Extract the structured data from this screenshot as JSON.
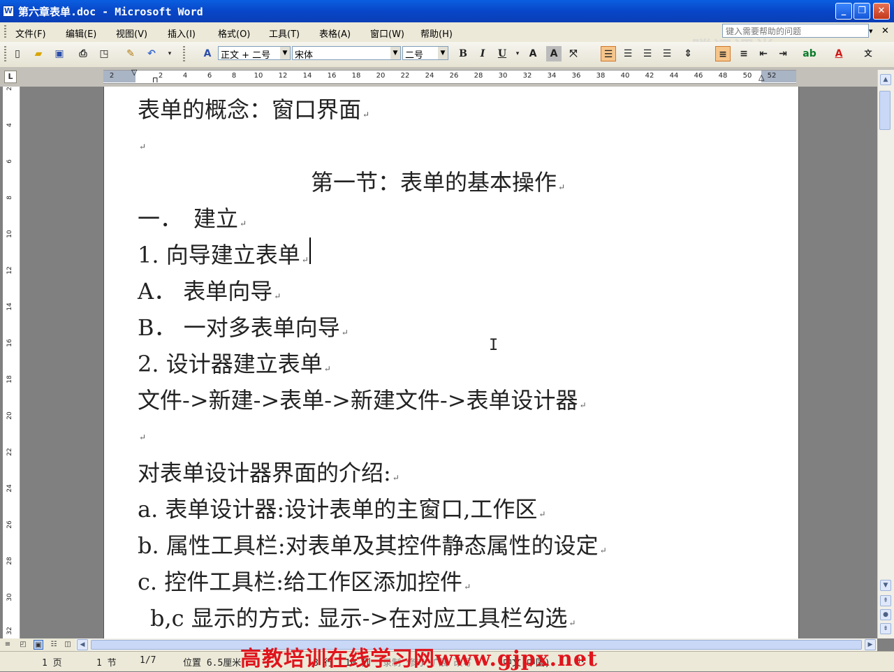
{
  "window": {
    "title": "第六章表单.doc - Microsoft Word",
    "icon": "word-doc-icon",
    "controls": {
      "minimize": "_",
      "maximize": "❐",
      "close": "✕"
    }
  },
  "menu": {
    "items": [
      "文件(F)",
      "编辑(E)",
      "视图(V)",
      "插入(I)",
      "格式(O)",
      "工具(T)",
      "表格(A)",
      "窗口(W)",
      "帮助(H)"
    ],
    "help_placeholder": "键入需要帮助的问题",
    "close_doc": "✕"
  },
  "toolbar": {
    "style": "正文 + 二号",
    "font": "宋体",
    "size": "二号",
    "bold": "B",
    "italic": "I",
    "underline": "U"
  },
  "ruler": {
    "ticks": [
      "2",
      "2",
      "4",
      "6",
      "8",
      "10",
      "12",
      "14",
      "16",
      "18",
      "20",
      "22",
      "24",
      "26",
      "28",
      "30",
      "32",
      "34",
      "36",
      "38",
      "40",
      "42",
      "44",
      "46",
      "48",
      "50",
      "52"
    ],
    "vticks": [
      "2",
      "4",
      "6",
      "8",
      "10",
      "12",
      "14",
      "16",
      "18",
      "20",
      "22",
      "24",
      "26",
      "28",
      "30",
      "32"
    ]
  },
  "document": {
    "lines": [
      "表单的概念：窗口界面",
      "",
      "第一节：表单的基本操作",
      "一．　建立",
      "1. 向导建立表单",
      "A．  表单向导",
      "B．  一对多表单向导",
      "2. 设计器建立表单",
      "文件->新建->表单->新建文件->表单设计器",
      "",
      "对表单设计器界面的介绍:",
      "a. 表单设计器:设计表单的主窗口,工作区",
      "b. 属性工具栏:对表单及其控件静态属性的设定",
      "c. 控件工具栏:给工作区添加控件",
      "b,c 显示的方式:  显示->在对应工具栏勾选"
    ]
  },
  "status": {
    "page": "1 页",
    "section": "1 节",
    "pages": "1/7",
    "position": "位置 6.5厘米",
    "line": "8 行",
    "column": "10 列",
    "modes": "录制  修订  扩展  改写",
    "language": "中文(中国)"
  },
  "overlay": {
    "watermark": "高教培训在线学习网www.gjpx.net",
    "logo": "腾讯课堂"
  },
  "colors": {
    "title_bar": "#0a4fd0",
    "chrome": "#ece9d8",
    "watermark": "#e0141c"
  }
}
